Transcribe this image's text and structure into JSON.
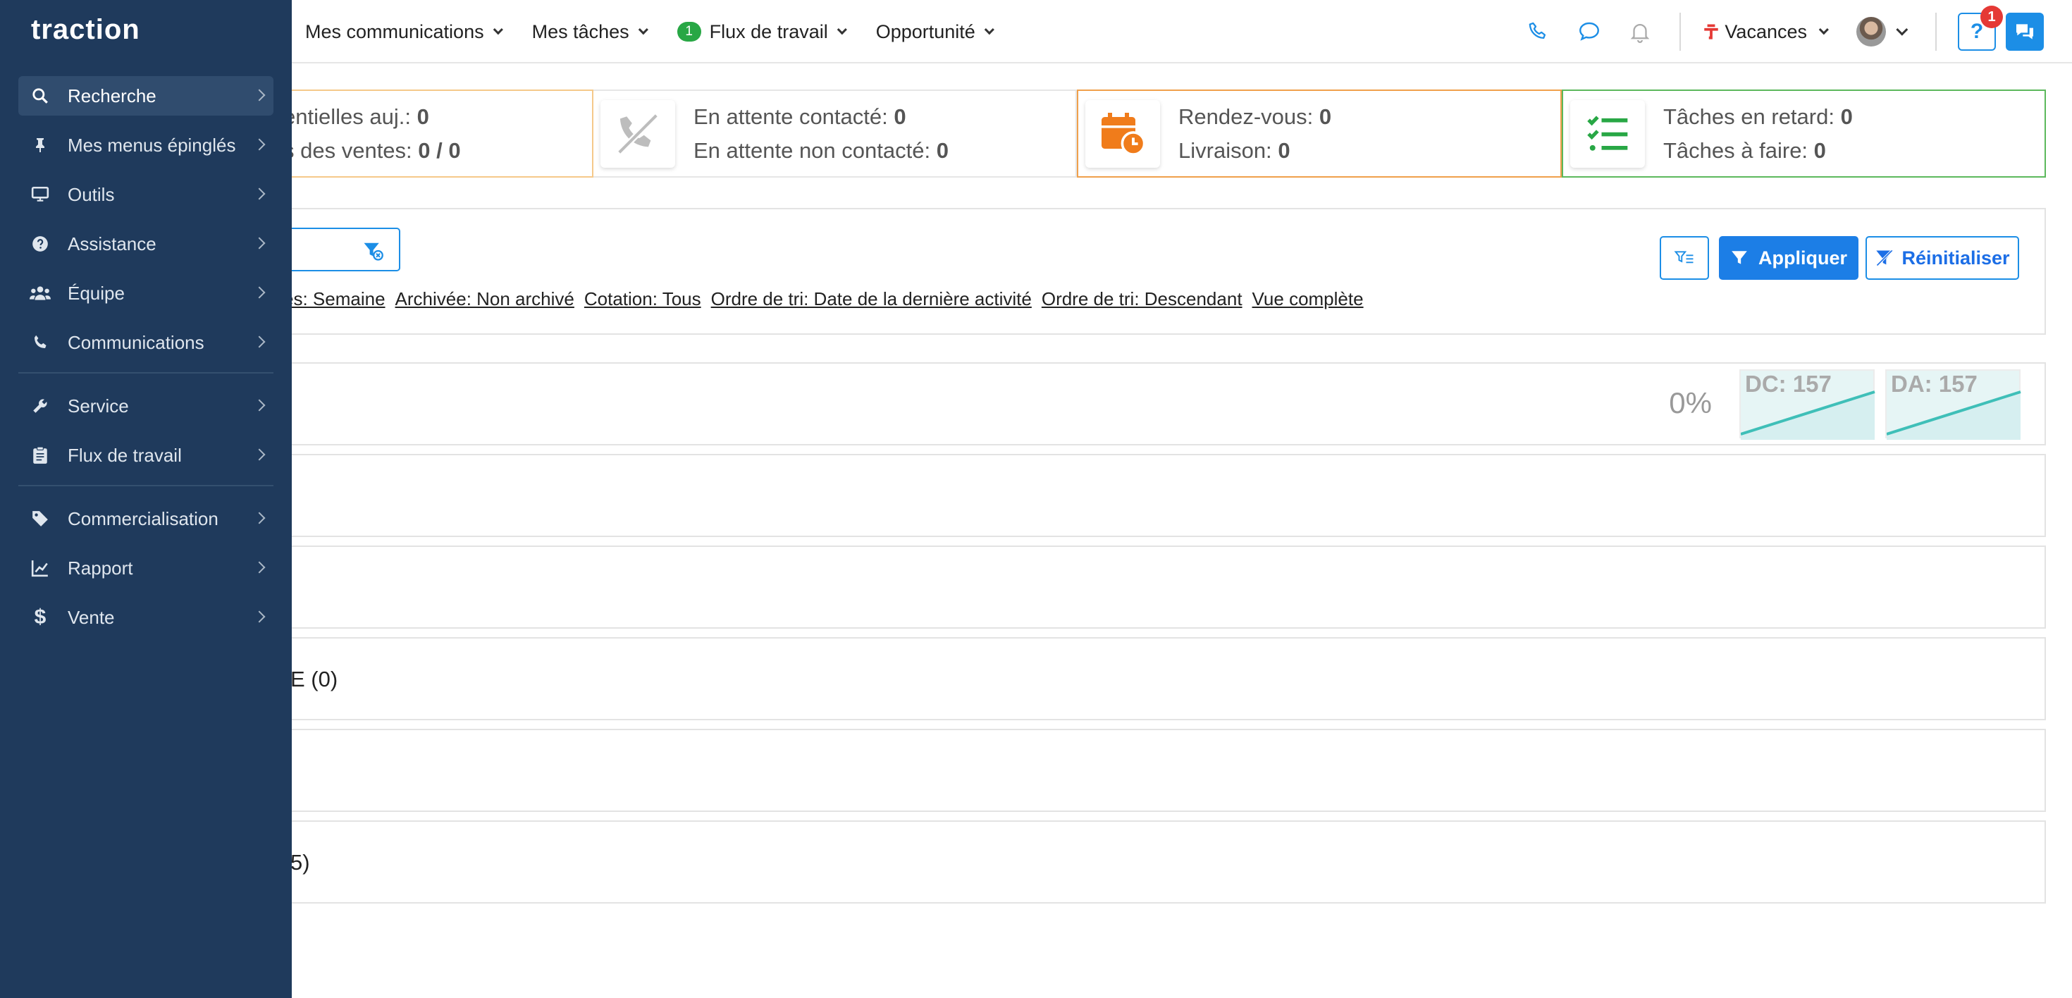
{
  "topnav": {
    "items": [
      {
        "label": "Mes communications"
      },
      {
        "label": "Mes tâches"
      },
      {
        "label": "Flux de travail",
        "badge": "1"
      },
      {
        "label": "Opportunité"
      }
    ],
    "vacances_label": "Vacances",
    "help_count": "1",
    "help_symbol": "?"
  },
  "stats": {
    "card1": {
      "line1_label": "entielles auj.:",
      "line1_value": "0",
      "line2_label": "s des ventes:",
      "line2_value": "0 / 0",
      "border": "#f5c98a"
    },
    "card2": {
      "line1_label": "En attente contacté:",
      "line1_value": "0",
      "line2_label": "En attente non contacté:",
      "line2_value": "0",
      "icon": "phone-slash-icon"
    },
    "card3": {
      "line1_label": "Rendez-vous:",
      "line1_value": "0",
      "line2_label": "Livraison:",
      "line2_value": "0",
      "icon": "calendar-clock-icon",
      "border": "#f0a04b"
    },
    "card4": {
      "line1_label": "Tâches en retard:",
      "line1_value": "0",
      "line2_label": "Tâches à faire:",
      "line2_value": "0",
      "icon": "task-list-icon",
      "border": "#5cb85c"
    }
  },
  "filters": {
    "chips": [
      "es: Semaine",
      "Archivée: Non archivé",
      "Cotation: Tous",
      "Ordre de tri: Date de la dernière activité",
      "Ordre de tri: Descendant",
      "Vue complète"
    ],
    "apply_label": "Appliquer",
    "reset_label": "Réinitialiser"
  },
  "rows": {
    "summary": {
      "percent": "0%",
      "dc_label": "DC: 157",
      "da_label": "DA: 157"
    },
    "row2_text": "",
    "row3_text": "",
    "row4_text": "E (0)",
    "row5_text": "",
    "row6_text": "5)"
  },
  "sidebar": {
    "logo": "traction",
    "items": [
      {
        "label": "Recherche",
        "icon": "search-icon"
      },
      {
        "label": "Mes menus épinglés",
        "icon": "pin-icon"
      },
      {
        "label": "Outils",
        "icon": "monitor-icon"
      },
      {
        "label": "Assistance",
        "icon": "question-circle-icon"
      },
      {
        "label": "Équipe",
        "icon": "users-icon"
      },
      {
        "label": "Communications",
        "icon": "phone-icon"
      },
      {
        "label": "Service",
        "icon": "wrench-icon"
      },
      {
        "label": "Flux de travail",
        "icon": "clipboard-icon"
      },
      {
        "label": "Commercialisation",
        "icon": "tag-icon"
      },
      {
        "label": "Rapport",
        "icon": "line-chart-icon"
      },
      {
        "label": "Vente",
        "icon": "dollar-icon"
      }
    ]
  },
  "colors": {
    "accent": "#1c8ee6",
    "sidebar_bg": "#1f3a5c",
    "orange": "#f07c1b",
    "green": "#28a745",
    "teal": "#3fbfb8"
  }
}
